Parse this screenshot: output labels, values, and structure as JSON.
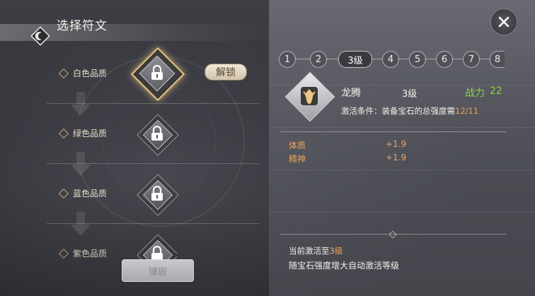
{
  "header": {
    "title": "选择符文"
  },
  "qualities": [
    {
      "label": "白色品质",
      "locked": true
    },
    {
      "label": "绿色品质",
      "locked": true
    },
    {
      "label": "蓝色品质",
      "locked": true
    },
    {
      "label": "紫色品质",
      "locked": true
    }
  ],
  "unlock_label": "解锁",
  "embed_label": "镶嵌",
  "tabs": [
    "1",
    "2",
    "3级",
    "4",
    "5",
    "6",
    "7",
    "8"
  ],
  "rune": {
    "name": "龙腾",
    "level": "3级",
    "power_label": "战力",
    "power_value": "22",
    "condition_text": "激活条件：装备宝石的总强度需",
    "condition_progress": "12/11"
  },
  "stats": [
    {
      "name": "体质",
      "value": "+1.9"
    },
    {
      "name": "精神",
      "value": "+1.9"
    }
  ],
  "current_prefix": "当前激活至",
  "current_level": "3级",
  "auto_text": "随宝石强度增大自动激活等级",
  "colors": {
    "accent_orange": "#e9a55c",
    "power_green": "#8ad24a",
    "gold": "#e9c684"
  }
}
